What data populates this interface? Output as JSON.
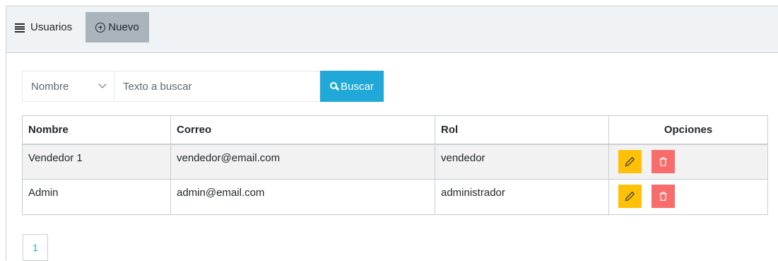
{
  "header": {
    "title": "Usuarios",
    "menu_icon": "hamburger-menu-icon",
    "new_button": {
      "label": "Nuevo",
      "icon": "plus-circle-icon"
    }
  },
  "search": {
    "field_selected": "Nombre",
    "placeholder": "Texto a buscar",
    "button_label": "Buscar",
    "button_icon": "search-icon",
    "button_color": "#20a8d8"
  },
  "table": {
    "columns": [
      "Nombre",
      "Correo",
      "Rol",
      "Opciones"
    ],
    "rows": [
      {
        "nombre": "Vendedor 1",
        "correo": "vendedor@email.com",
        "rol": "vendedor"
      },
      {
        "nombre": "Admin",
        "correo": "admin@email.com",
        "rol": "administrador"
      }
    ],
    "row_actions": {
      "edit": {
        "icon": "pencil-icon",
        "color": "#ffc107"
      },
      "delete": {
        "icon": "trash-icon",
        "color": "#f86c6b"
      }
    }
  },
  "pagination": {
    "pages": [
      "1"
    ]
  }
}
